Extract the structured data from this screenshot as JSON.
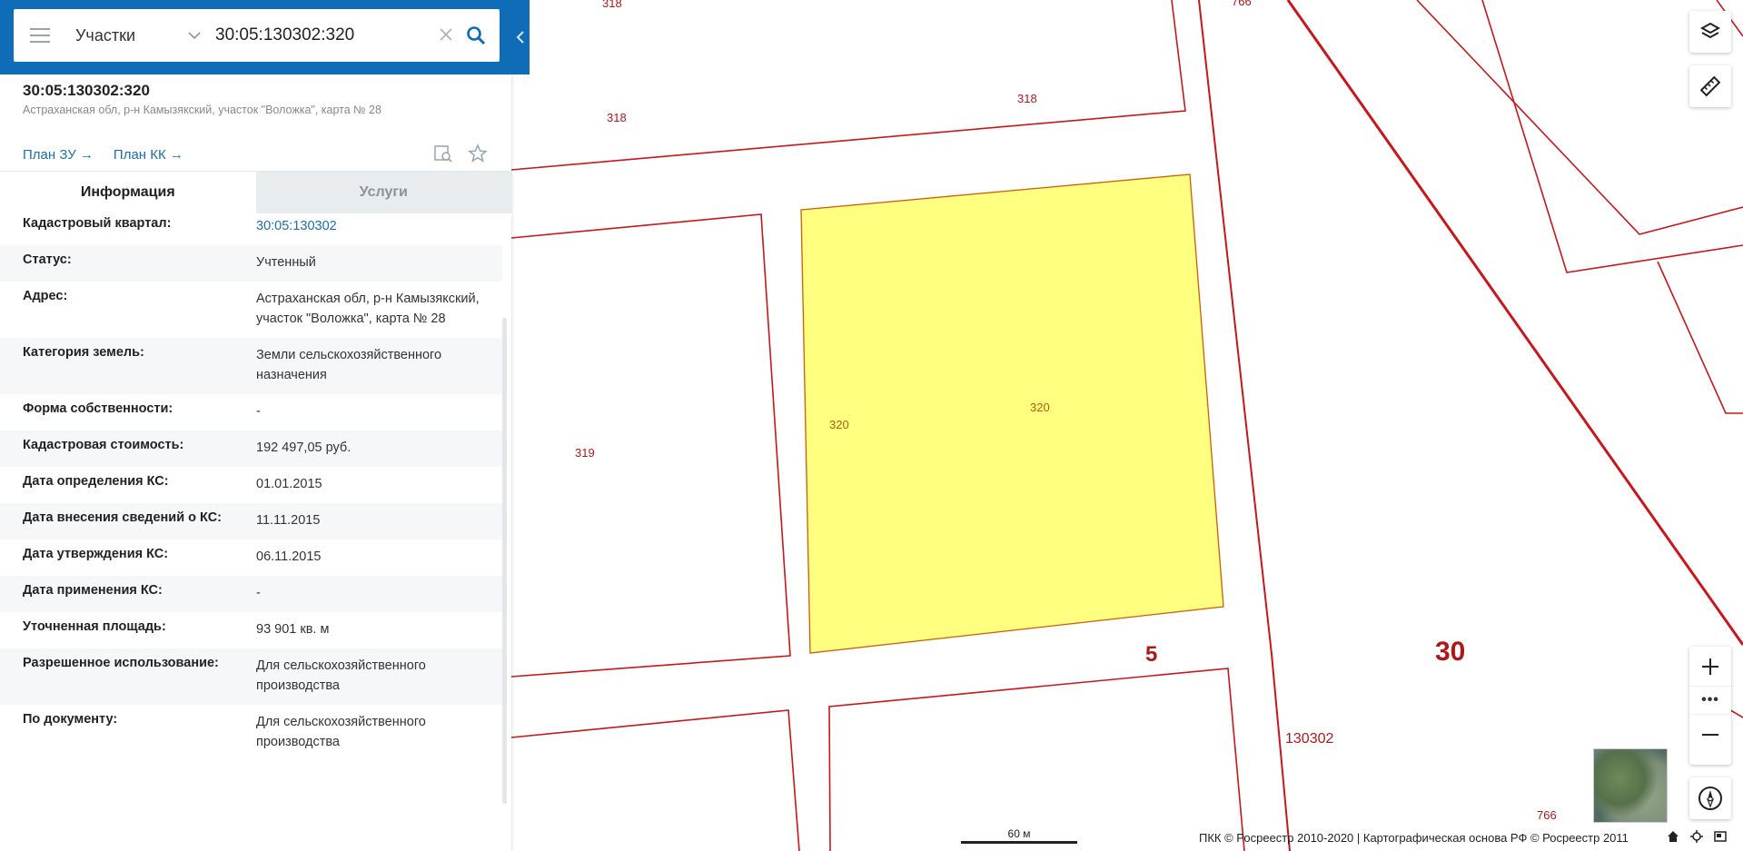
{
  "search": {
    "type_label": "Участки",
    "query": "30:05:130302:320"
  },
  "object": {
    "number": "30:05:130302:320",
    "address": "Астраханская обл, р-н Камызякский, участок \"Воложка\", карта № 28",
    "plan_zu": "План ЗУ",
    "plan_kk": "План КК"
  },
  "tabs": {
    "info": "Информация",
    "services": "Услуги"
  },
  "info_rows": [
    {
      "key": "Кадастровый квартал:",
      "value": "30:05:130302"
    },
    {
      "key": "Статус:",
      "value": "Учтенный"
    },
    {
      "key": "Адрес:",
      "value": "Астраханская обл, р-н Камызякский, участок \"Воложка\", карта № 28"
    },
    {
      "key": "Категория земель:",
      "value": "Земли сельскохозяйственного назначения"
    },
    {
      "key": "Форма собственности:",
      "value": "-"
    },
    {
      "key": "Кадастровая стоимость:",
      "value": "192 497,05 руб."
    },
    {
      "key": "Дата определения КС:",
      "value": "01.01.2015"
    },
    {
      "key": "Дата внесения сведений о КС:",
      "value": "11.11.2015"
    },
    {
      "key": "Дата утверждения КС:",
      "value": "06.11.2015"
    },
    {
      "key": "Дата применения КС:",
      "value": "-"
    },
    {
      "key": "Уточненная площадь:",
      "value": "93 901 кв. м"
    },
    {
      "key": "Разрешенное использование:",
      "value": "Для сельскохозяйственного производства"
    },
    {
      "key": "По документу:",
      "value": "Для сельскохозяйственного производства"
    }
  ],
  "map_labels": {
    "p318_top": "318",
    "p766_top": "766",
    "p318_a": "318",
    "p318_b": "318",
    "p319": "319",
    "p320_left": "320",
    "p320_center": "320",
    "block5": "5",
    "block30": "30",
    "quarter": "130302",
    "p766_bottom": "766"
  },
  "scale_label": "60 м",
  "zoom_dots": "•••",
  "attribution": "ПКК © Росреестр 2010-2020 | Картографическая основа РФ © Росреестр 2011",
  "colors": {
    "brand_blue": "#0f6cb6",
    "parcel_fill": "#ffff80",
    "boundary_red": "#c01a1a"
  }
}
